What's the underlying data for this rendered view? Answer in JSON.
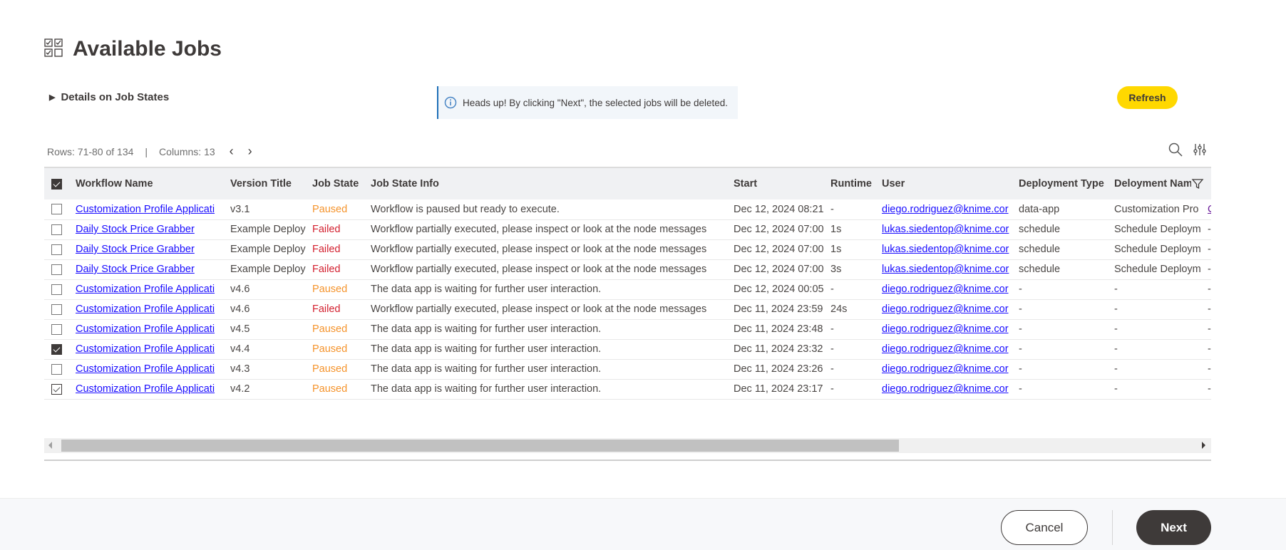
{
  "header": {
    "title": "Available Jobs",
    "icon": "checklist-icon"
  },
  "details": {
    "label": "Details on Job States"
  },
  "notice": {
    "text": "Heads up! By clicking \"Next\", the selected jobs will be deleted.",
    "icon": "info-icon"
  },
  "toolbar": {
    "refresh_label": "Refresh",
    "rows_label": "Rows: 71-80 of 134",
    "separator": "|",
    "columns_label": "Columns: 13"
  },
  "colors": {
    "accent": "#ffd800",
    "paused": "#f5932b",
    "failed": "#d3202f",
    "link": "#1a0dff",
    "dark": "#3e3a39"
  },
  "table": {
    "header_checkbox": "checked",
    "columns": [
      "Workflow Name",
      "Version Title",
      "Job State",
      "Job State Info",
      "Start",
      "Runtime",
      "User",
      "Deployment Type",
      "Deloyment Nam",
      ""
    ],
    "rows": [
      {
        "checked": "none",
        "workflow": "Customization Profile Applicati",
        "version": "v3.1",
        "state": "Paused",
        "info": "Workflow is paused but ready to execute.",
        "start": "Dec 12, 2024 08:21",
        "runtime": "-",
        "user": "diego.rodriguez@knime.cor",
        "dtype": "data-app",
        "dname": "Customization Pro",
        "extra": "C"
      },
      {
        "checked": "none",
        "workflow": "Daily Stock Price Grabber",
        "version": "Example Deploy",
        "state": "Failed",
        "info": "Workflow partially executed, please inspect or look at the node messages",
        "start": "Dec 12, 2024 07:00",
        "runtime": "1s",
        "user": "lukas.siedentop@knime.cor",
        "dtype": "schedule",
        "dname": "Schedule Deploym",
        "extra": "-"
      },
      {
        "checked": "none",
        "workflow": "Daily Stock Price Grabber",
        "version": "Example Deploy",
        "state": "Failed",
        "info": "Workflow partially executed, please inspect or look at the node messages",
        "start": "Dec 12, 2024 07:00",
        "runtime": "1s",
        "user": "lukas.siedentop@knime.cor",
        "dtype": "schedule",
        "dname": "Schedule Deploym",
        "extra": "-"
      },
      {
        "checked": "none",
        "workflow": "Daily Stock Price Grabber",
        "version": "Example Deploy",
        "state": "Failed",
        "info": "Workflow partially executed, please inspect or look at the node messages",
        "start": "Dec 12, 2024 07:00",
        "runtime": "3s",
        "user": "lukas.siedentop@knime.cor",
        "dtype": "schedule",
        "dname": "Schedule Deploym",
        "extra": "-"
      },
      {
        "checked": "none",
        "workflow": "Customization Profile Applicati",
        "version": "v4.6",
        "state": "Paused",
        "info": "The data app is waiting for further user interaction.",
        "start": "Dec 12, 2024 00:05",
        "runtime": "-",
        "user": "diego.rodriguez@knime.cor",
        "dtype": "-",
        "dname": "-",
        "extra": "-"
      },
      {
        "checked": "none",
        "workflow": "Customization Profile Applicati",
        "version": "v4.6",
        "state": "Failed",
        "info": "Workflow partially executed, please inspect or look at the node messages",
        "start": "Dec 11, 2024 23:59",
        "runtime": "24s",
        "user": "diego.rodriguez@knime.cor",
        "dtype": "-",
        "dname": "-",
        "extra": "-"
      },
      {
        "checked": "none",
        "workflow": "Customization Profile Applicati",
        "version": "v4.5",
        "state": "Paused",
        "info": "The data app is waiting for further user interaction.",
        "start": "Dec 11, 2024 23:48",
        "runtime": "-",
        "user": "diego.rodriguez@knime.cor",
        "dtype": "-",
        "dname": "-",
        "extra": "-"
      },
      {
        "checked": "on",
        "workflow": "Customization Profile Applicati",
        "version": "v4.4",
        "state": "Paused",
        "info": "The data app is waiting for further user interaction.",
        "start": "Dec 11, 2024 23:32",
        "runtime": "-",
        "user": "diego.rodriguez@knime.cor",
        "dtype": "-",
        "dname": "-",
        "extra": "-"
      },
      {
        "checked": "none",
        "workflow": "Customization Profile Applicati",
        "version": "v4.3",
        "state": "Paused",
        "info": "The data app is waiting for further user interaction.",
        "start": "Dec 11, 2024 23:26",
        "runtime": "-",
        "user": "diego.rodriguez@knime.cor",
        "dtype": "-",
        "dname": "-",
        "extra": "-"
      },
      {
        "checked": "chk",
        "workflow": "Customization Profile Applicati",
        "version": "v4.2",
        "state": "Paused",
        "info": "The data app is waiting for further user interaction.",
        "start": "Dec 11, 2024 23:17",
        "runtime": "-",
        "user": "diego.rodriguez@knime.cor",
        "dtype": "-",
        "dname": "-",
        "extra": "-"
      }
    ]
  },
  "footer": {
    "cancel_label": "Cancel",
    "next_label": "Next"
  }
}
